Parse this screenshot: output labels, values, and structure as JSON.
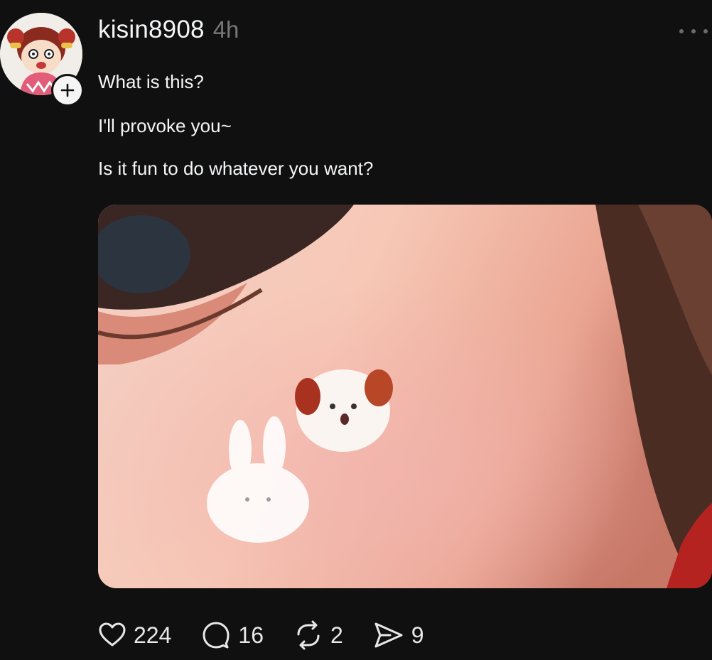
{
  "post": {
    "author": {
      "username": "kisin8908",
      "time": "4h",
      "avatar_icon": "cartoon-girl-avatar",
      "follow_icon": "plus-icon"
    },
    "lines": [
      "What is this?",
      "I'll provoke you~",
      "Is it fun to do whatever you want?"
    ],
    "media": {
      "description_icon": "photo-cheek-with-dog-and-bunny-stickers"
    },
    "actions": {
      "likes": "224",
      "replies": "16",
      "reposts": "2",
      "shares": "9"
    }
  },
  "colors": {
    "background": "#101010",
    "text": "#f3f5f7",
    "muted": "#777777"
  }
}
